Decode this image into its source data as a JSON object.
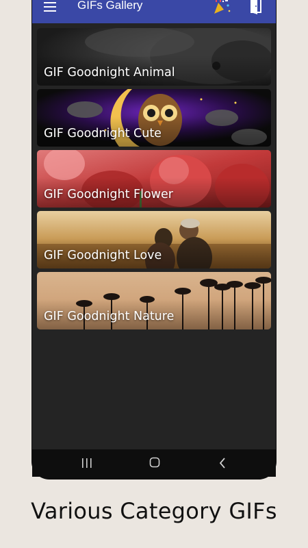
{
  "app": {
    "title": "GIFs Gallery"
  },
  "icons": {
    "menu": "menu-icon",
    "party": "party-popper-icon",
    "exit": "exit-door-icon",
    "nav_recent": "recent-apps-icon",
    "nav_home": "home-icon",
    "nav_back": "back-chevron-icon"
  },
  "categories": [
    {
      "label": "GIF Goodnight Animal"
    },
    {
      "label": "GIF Goodnight Cute"
    },
    {
      "label": "GIF Goodnight Flower"
    },
    {
      "label": "GIF Goodnight Love"
    },
    {
      "label": "GIF Goodnight Nature"
    }
  ],
  "caption": "Various Category GIFs",
  "colors": {
    "appbar": "#3a48a6",
    "screen_bg": "#242424",
    "page_bg": "#ebe6e0"
  }
}
